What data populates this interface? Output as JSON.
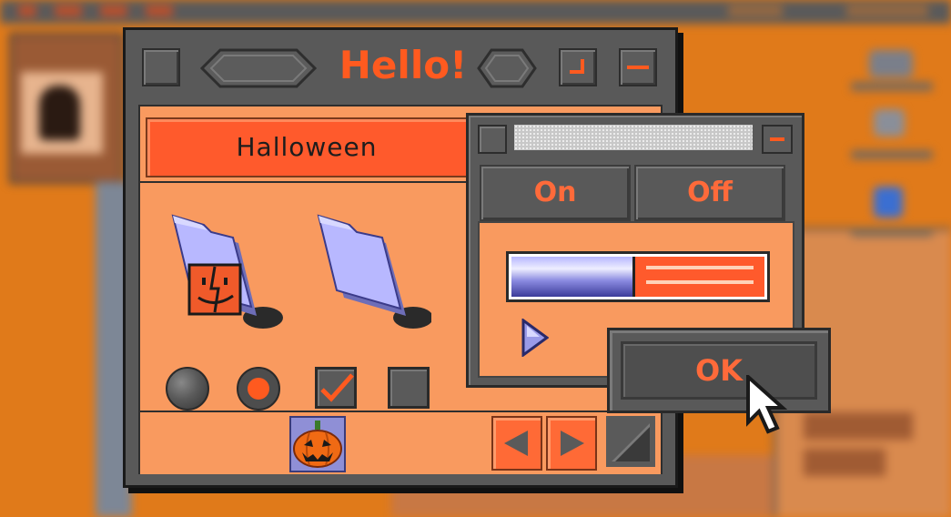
{
  "window": {
    "title": "Hello!",
    "close_button": "close-box",
    "zoom_button": "zoom-box",
    "collapse_button": "collapse-box"
  },
  "tabs": [
    {
      "label": "Halloween",
      "active": true
    }
  ],
  "icons": [
    "finder-folder-icon",
    "folder-icon",
    "pumpkin-icon",
    "play-triangle-icon"
  ],
  "controls": {
    "radio_unselected": false,
    "radio_selected": true,
    "checkbox_checked": true,
    "checkbox_unchecked": false
  },
  "panel": {
    "segment_on": "On",
    "segment_off": "Off",
    "slider_value": 0.48,
    "ok_label": "OK"
  },
  "colors": {
    "accent": "#ff5a1f",
    "content_bg": "#f99a5f",
    "chrome": "#595959",
    "desktop": "#e07a1a"
  }
}
